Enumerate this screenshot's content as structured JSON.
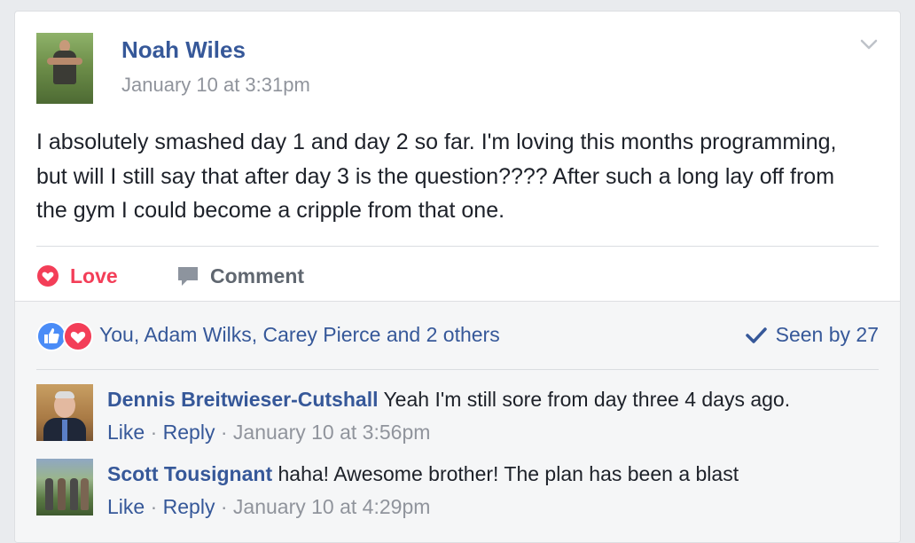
{
  "post": {
    "author": "Noah Wiles",
    "time": "January 10 at 3:31pm",
    "body": "I absolutely smashed day 1 and day 2 so far. I'm loving this months programming, but will I still say that after day 3 is the question???? After such a long lay off from the gym I could become a cripple from that one."
  },
  "actions": {
    "love_label": "Love",
    "comment_label": "Comment"
  },
  "reactions": {
    "summary": "You, Adam Wilks, Carey Pierce and 2 others",
    "seen": "Seen by 27"
  },
  "comments": [
    {
      "author": "Dennis Breitwieser-Cutshall",
      "text": "Yeah I'm still sore from day three 4 days ago.",
      "like_label": "Like",
      "reply_label": "Reply",
      "time": "January 10 at 3:56pm"
    },
    {
      "author": "Scott Tousignant",
      "text": "haha! Awesome brother! The plan has been a blast",
      "like_label": "Like",
      "reply_label": "Reply",
      "time": "January 10 at 4:29pm"
    }
  ],
  "separator": " · ",
  "icons": {
    "menu": "chevron-down-icon",
    "love": "heart-icon",
    "comment": "speech-bubble-icon",
    "like_reaction": "thumbs-up-icon",
    "love_reaction": "heart-icon",
    "seen": "checkmark-icon"
  },
  "colors": {
    "link": "#365899",
    "love": "#f33e58",
    "like_reaction": "#4a8cf7",
    "muted": "#90949c"
  }
}
